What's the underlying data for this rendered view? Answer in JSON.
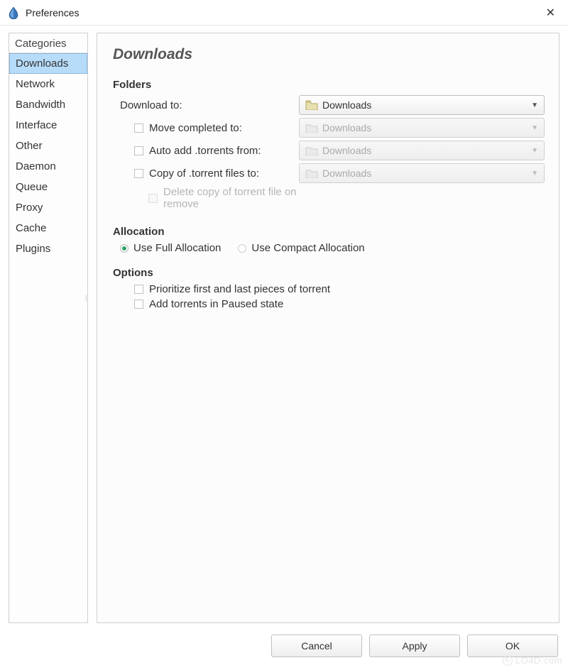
{
  "window": {
    "title": "Preferences"
  },
  "sidebar": {
    "header": "Categories",
    "items": [
      {
        "label": "Downloads",
        "selected": true
      },
      {
        "label": "Network",
        "selected": false
      },
      {
        "label": "Bandwidth",
        "selected": false
      },
      {
        "label": "Interface",
        "selected": false
      },
      {
        "label": "Other",
        "selected": false
      },
      {
        "label": "Daemon",
        "selected": false
      },
      {
        "label": "Queue",
        "selected": false
      },
      {
        "label": "Proxy",
        "selected": false
      },
      {
        "label": "Cache",
        "selected": false
      },
      {
        "label": "Plugins",
        "selected": false
      }
    ]
  },
  "panel": {
    "title": "Downloads",
    "folders": {
      "section_title": "Folders",
      "download_to": {
        "label": "Download to:",
        "value": "Downloads",
        "enabled": true
      },
      "move_completed": {
        "label": "Move completed to:",
        "value": "Downloads",
        "checked": false,
        "enabled": false
      },
      "auto_add": {
        "label": "Auto add .torrents from:",
        "value": "Downloads",
        "checked": false,
        "enabled": false
      },
      "copy_to": {
        "label": "Copy of .torrent files to:",
        "value": "Downloads",
        "checked": false,
        "enabled": false
      },
      "delete_copy": {
        "label": "Delete copy of torrent file on remove",
        "checked": false,
        "enabled": false
      }
    },
    "allocation": {
      "section_title": "Allocation",
      "full": {
        "label": "Use Full Allocation",
        "checked": true
      },
      "compact": {
        "label": "Use Compact Allocation",
        "checked": false
      }
    },
    "options": {
      "section_title": "Options",
      "prioritize": {
        "label": "Prioritize first and last pieces of torrent",
        "checked": false
      },
      "paused": {
        "label": "Add torrents in Paused state",
        "checked": false
      }
    }
  },
  "buttons": {
    "cancel": "Cancel",
    "apply": "Apply",
    "ok": "OK"
  },
  "watermark": "LO4D.com"
}
